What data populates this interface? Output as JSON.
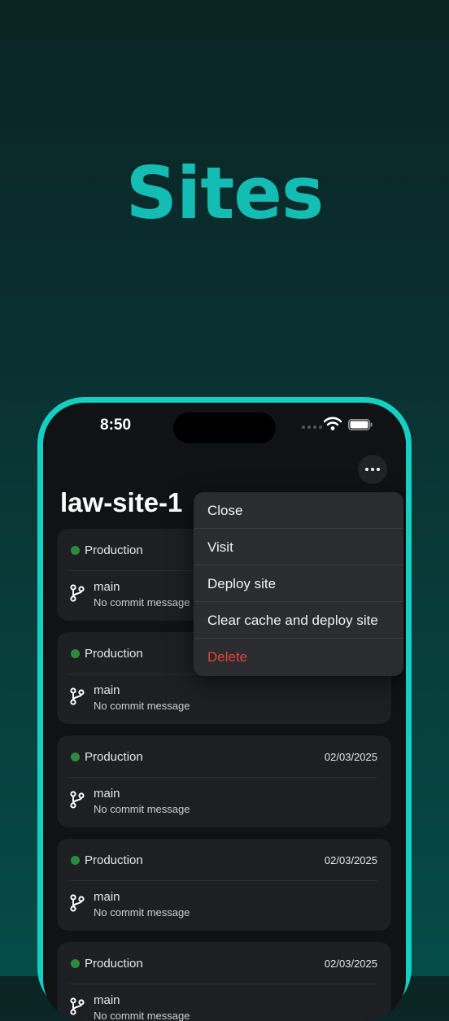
{
  "hero": {
    "title": "Sites"
  },
  "status_bar": {
    "time": "8:50"
  },
  "header": {
    "title": "law-site-1"
  },
  "menu": {
    "items": [
      {
        "label": "Close"
      },
      {
        "label": "Visit"
      },
      {
        "label": "Deploy site"
      },
      {
        "label": "Clear cache and deploy site"
      },
      {
        "label": "Delete"
      }
    ]
  },
  "deploys": [
    {
      "env": "Production",
      "date": "",
      "branch": "main",
      "commit": "No commit message"
    },
    {
      "env": "Production",
      "date": "",
      "branch": "main",
      "commit": "No commit message"
    },
    {
      "env": "Production",
      "date": "02/03/2025",
      "branch": "main",
      "commit": "No commit message"
    },
    {
      "env": "Production",
      "date": "02/03/2025",
      "branch": "main",
      "commit": "No commit message"
    },
    {
      "env": "Production",
      "date": "02/03/2025",
      "branch": "main",
      "commit": "No commit message"
    }
  ],
  "colors": {
    "accent": "#13bdb3",
    "status_live": "#2c8a3d",
    "danger": "#e5423b"
  },
  "icons": {
    "more": "ellipsis-icon",
    "branch": "git-branch-icon",
    "wifi": "wifi-icon",
    "battery": "battery-icon"
  }
}
